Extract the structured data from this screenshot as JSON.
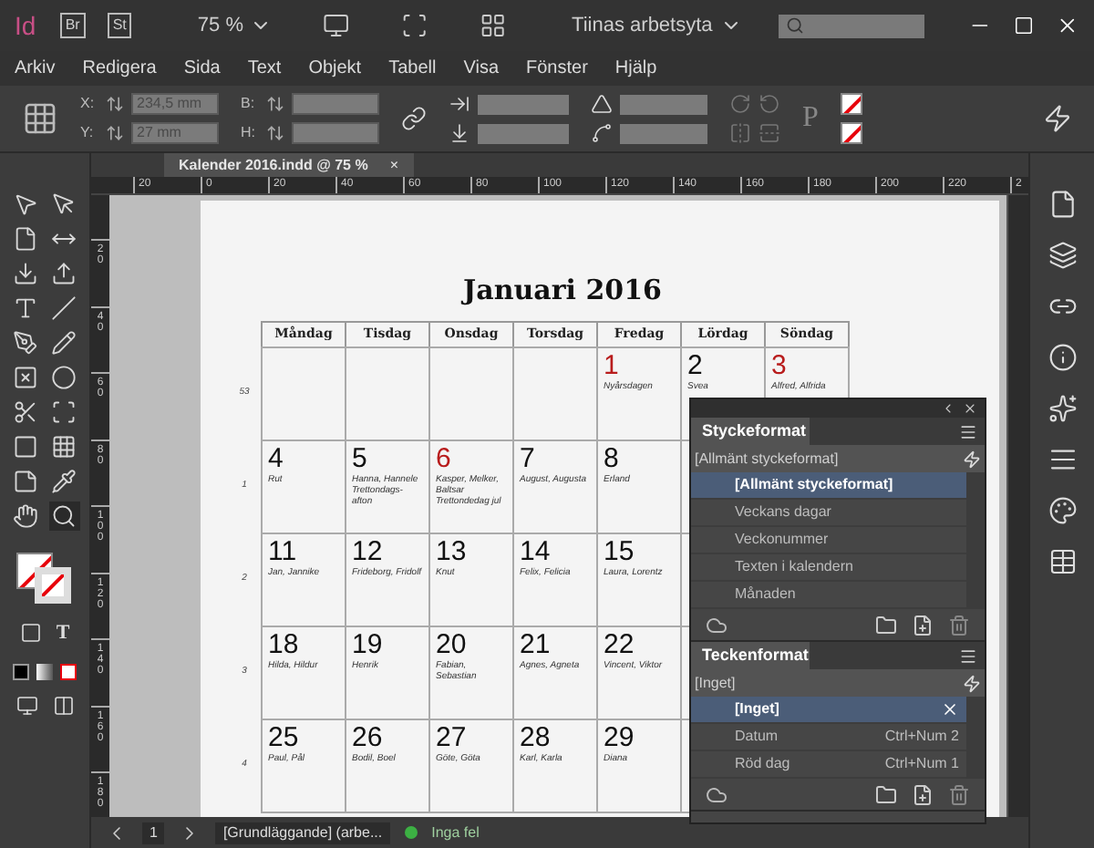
{
  "app_bar": {
    "logo": "Id",
    "apps": [
      "Br",
      "St"
    ],
    "zoom": "75 %",
    "workspace": "Tiinas arbetsyta"
  },
  "menu": [
    "Arkiv",
    "Redigera",
    "Sida",
    "Text",
    "Objekt",
    "Tabell",
    "Visa",
    "Fönster",
    "Hjälp"
  ],
  "control_panel": {
    "x_label": "X:",
    "x": "234,5 mm",
    "y_label": "Y:",
    "y": "27 mm",
    "w_label": "B:",
    "h_label": "H:",
    "glyph": "P"
  },
  "document_tab": {
    "title": "Kalender 2016.indd @ 75 %",
    "close": "×"
  },
  "ruler_h": [
    "20",
    "0",
    "20",
    "40",
    "60",
    "80",
    "100",
    "120",
    "140",
    "160",
    "180",
    "200",
    "220",
    "2"
  ],
  "ruler_v": [
    "20",
    "40",
    "60",
    "80",
    "100",
    "120",
    "140",
    "160",
    "180"
  ],
  "tools": [
    {
      "kind": "selection",
      "selected": false
    },
    {
      "kind": "direct",
      "selected": false
    },
    {
      "kind": "page",
      "selected": false
    },
    {
      "kind": "gap",
      "selected": false
    },
    {
      "kind": "collector",
      "selected": false
    },
    {
      "kind": "placer",
      "selected": false
    },
    {
      "kind": "type",
      "selected": false
    },
    {
      "kind": "line",
      "selected": false
    },
    {
      "kind": "pen",
      "selected": false
    },
    {
      "kind": "pencil",
      "selected": false
    },
    {
      "kind": "frame",
      "selected": false
    },
    {
      "kind": "ellipse",
      "selected": false
    },
    {
      "kind": "scissors",
      "selected": false
    },
    {
      "kind": "transform",
      "selected": false
    },
    {
      "kind": "gradient",
      "selected": false
    },
    {
      "kind": "feather",
      "selected": false
    },
    {
      "kind": "note",
      "selected": false
    },
    {
      "kind": "eyedropper",
      "selected": false
    },
    {
      "kind": "hand",
      "selected": false
    },
    {
      "kind": "zoom",
      "selected": true
    }
  ],
  "format_glyph": "T",
  "calendar": {
    "title": "Januari 2016",
    "weekdays": [
      "Måndag",
      "Tisdag",
      "Onsdag",
      "Torsdag",
      "Fredag",
      "Lördag",
      "Söndag"
    ],
    "weeks": [
      {
        "number": "53",
        "kind": "partial-start",
        "days": [
          {
            "date": "1",
            "names": "Nyårsdagen",
            "red": true
          },
          {
            "date": "2",
            "names": "Svea",
            "red": false
          },
          {
            "date": "3",
            "names": "Alfred, Alfrida",
            "red": true
          }
        ]
      },
      {
        "number": "1",
        "kind": "full",
        "days": [
          {
            "date": "4",
            "names": "Rut",
            "red": false
          },
          {
            "date": "5",
            "names": "Hanna, Hannele Trettondags-afton",
            "red": false
          },
          {
            "date": "6",
            "names": "Kasper, Melker, Baltsar Trettondedag jul",
            "red": true
          },
          {
            "date": "7",
            "names": "August, Augusta",
            "red": false
          },
          {
            "date": "8",
            "names": "Erland",
            "red": false
          }
        ]
      },
      {
        "number": "2",
        "kind": "full",
        "days": [
          {
            "date": "11",
            "names": "Jan, Jannike",
            "red": false
          },
          {
            "date": "12",
            "names": "Frideborg, Fridolf",
            "red": false
          },
          {
            "date": "13",
            "names": "Knut",
            "red": false
          },
          {
            "date": "14",
            "names": "Felix, Felicia",
            "red": false
          },
          {
            "date": "15",
            "names": "Laura, Lorentz",
            "red": false
          }
        ]
      },
      {
        "number": "3",
        "kind": "full",
        "days": [
          {
            "date": "18",
            "names": "Hilda, Hildur",
            "red": false
          },
          {
            "date": "19",
            "names": "Henrik",
            "red": false
          },
          {
            "date": "20",
            "names": "Fabian, Sebastian",
            "red": false
          },
          {
            "date": "21",
            "names": "Agnes, Agneta",
            "red": false
          },
          {
            "date": "22",
            "names": "Vincent, Viktor",
            "red": false
          }
        ]
      },
      {
        "number": "4",
        "kind": "full",
        "days": [
          {
            "date": "25",
            "names": "Paul, Pål",
            "red": false
          },
          {
            "date": "26",
            "names": "Bodil, Boel",
            "red": false
          },
          {
            "date": "27",
            "names": "Göte, Göta",
            "red": false
          },
          {
            "date": "28",
            "names": "Karl, Karla",
            "red": false
          },
          {
            "date": "29",
            "names": "Diana",
            "red": false
          }
        ]
      }
    ]
  },
  "paragraph_styles": {
    "title": "Styckeformat",
    "current": "[Allmänt styckeformat]",
    "items": [
      {
        "label": "[Allmänt styckeformat]",
        "selected": true
      },
      {
        "label": "Veckans dagar",
        "selected": false
      },
      {
        "label": "Veckonummer",
        "selected": false
      },
      {
        "label": "Texten i kalendern",
        "selected": false
      },
      {
        "label": "Månaden",
        "selected": false
      }
    ]
  },
  "character_styles": {
    "title": "Teckenformat",
    "current": "[Inget]",
    "items": [
      {
        "label": "[Inget]",
        "selected": true
      },
      {
        "label": "Datum",
        "shortcut": "Ctrl+Num 2",
        "selected": false
      },
      {
        "label": "Röd dag",
        "shortcut": "Ctrl+Num 1",
        "selected": false
      }
    ]
  },
  "status_bar": {
    "page": "1",
    "master": "[Grundläggande] (arbe...",
    "preflight": "Inga fel"
  }
}
